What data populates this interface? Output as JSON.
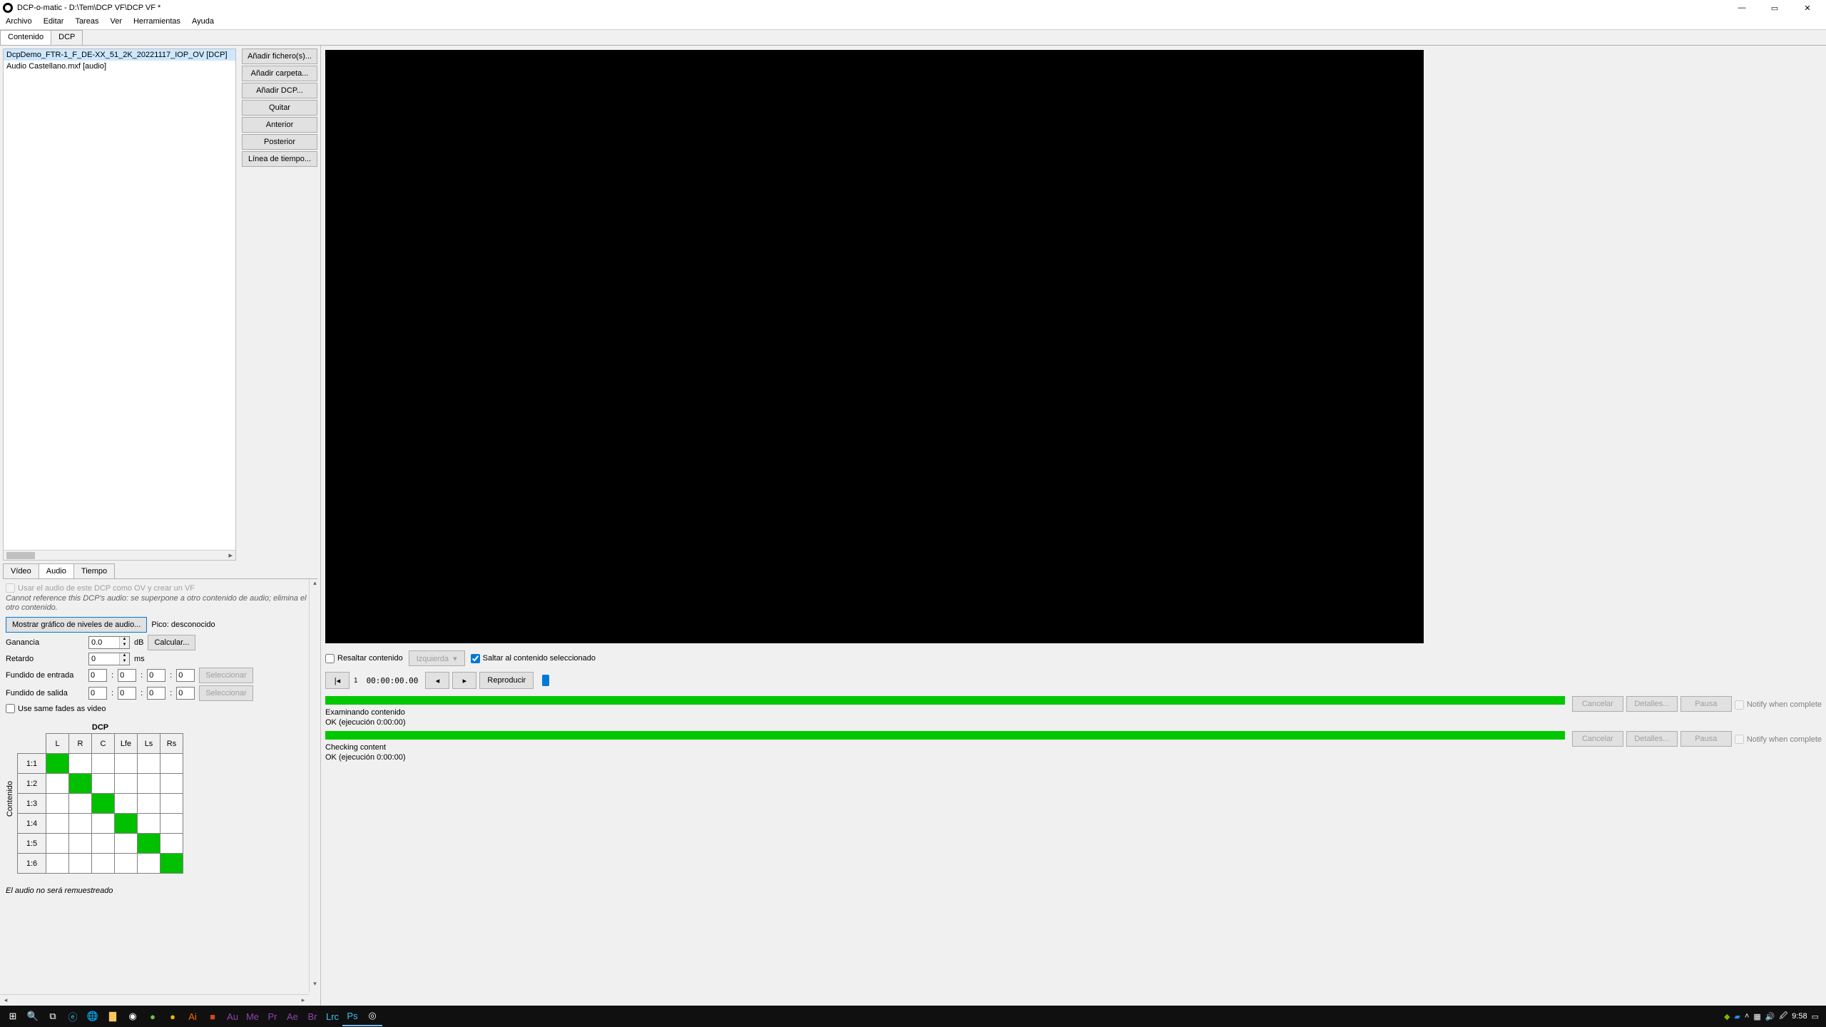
{
  "titlebar": {
    "title": "DCP-o-matic - D:\\Tem\\DCP VF\\DCP VF *"
  },
  "menu": [
    "Archivo",
    "Editar",
    "Tareas",
    "Ver",
    "Herramientas",
    "Ayuda"
  ],
  "main_tabs": {
    "active": 0,
    "items": [
      "Contenido",
      "DCP"
    ]
  },
  "content_list": [
    {
      "label": "DcpDemo_FTR-1_F_DE-XX_51_2K_20221117_IOP_OV [DCP]",
      "selected": true
    },
    {
      "label": "Audio Castellano.mxf [audio]",
      "selected": false
    }
  ],
  "content_buttons": [
    "Añadir fichero(s)...",
    "Añadir carpeta...",
    "Añadir DCP...",
    "Quitar",
    "Anterior",
    "Posterior",
    "Línea de tiempo..."
  ],
  "prop_tabs": {
    "active": 1,
    "items": [
      "Vídeo",
      "Audio",
      "Tiempo"
    ]
  },
  "audio": {
    "use_dcp_label": "Usar el audio de este DCP como OV y crear un VF",
    "note": "Cannot reference this DCP's audio: se superpone a otro contenido de audio; elimina el otro contenido.",
    "show_graph": "Mostrar gráfico de niveles de audio...",
    "peak_label": "Pico: desconocido",
    "gain_label": "Ganancia",
    "gain_value": "0.0",
    "gain_unit": "dB",
    "calc_btn": "Calcular...",
    "delay_label": "Retardo",
    "delay_value": "0",
    "delay_unit": "ms",
    "fade_in_label": "Fundido de entrada",
    "fade_out_label": "Fundido de salida",
    "fade_vals": [
      "0",
      "0",
      "0",
      "0"
    ],
    "select_btn": "Seleccionar",
    "same_fades_label": "Use same fades as video",
    "matrix_title": "DCP",
    "matrix_side": "Contenido",
    "cols": [
      "L",
      "R",
      "C",
      "Lfe",
      "Ls",
      "Rs"
    ],
    "rows": [
      "1:1",
      "1:2",
      "1:3",
      "1:4",
      "1:5",
      "1:6"
    ],
    "matrix": [
      [
        1,
        0,
        0,
        0,
        0,
        0
      ],
      [
        0,
        1,
        0,
        0,
        0,
        0
      ],
      [
        0,
        0,
        1,
        0,
        0,
        0
      ],
      [
        0,
        0,
        0,
        1,
        0,
        0
      ],
      [
        0,
        0,
        0,
        0,
        1,
        0
      ],
      [
        0,
        0,
        0,
        0,
        0,
        1
      ]
    ],
    "resample_note": "El audio no será remuestreado"
  },
  "preview": {
    "highlight": "Resaltar contenido",
    "left_btn": "Izquierda",
    "jump": "Saltar al contenido seleccionado",
    "frame_no": "1",
    "timecode": "00:00:00.00",
    "play_btn": "Reproducir"
  },
  "jobs": [
    {
      "title": "Examinando contenido",
      "status": "OK (ejecución 0:00:00)",
      "cancel": "Cancelar",
      "details": "Detalles...",
      "pause": "Pausa",
      "notify": "Notify when complete"
    },
    {
      "title": "Checking content",
      "status": "OK (ejecución 0:00:00)",
      "cancel": "Cancelar",
      "details": "Detalles...",
      "pause": "Pausa",
      "notify": "Notify when complete"
    }
  ],
  "taskbar": {
    "time": "9:58",
    "date": "  "
  }
}
